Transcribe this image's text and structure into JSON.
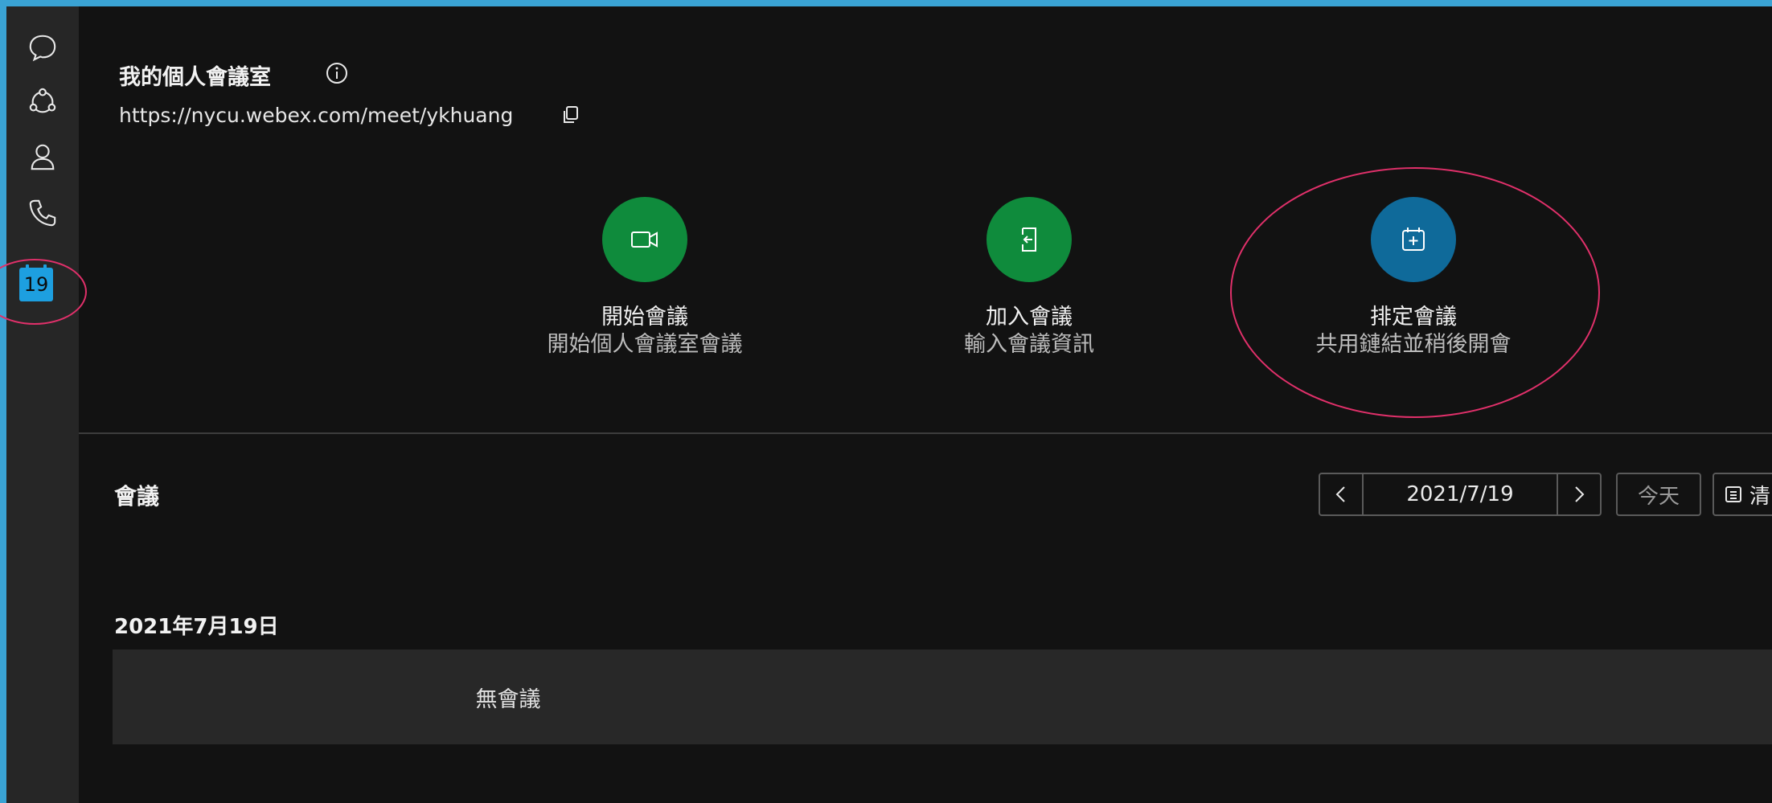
{
  "sidebar": {
    "items": [
      {
        "icon": "chat-bubble-icon",
        "label": "訊息"
      },
      {
        "icon": "teams-icon",
        "label": "小組"
      },
      {
        "icon": "contacts-icon",
        "label": "聯絡人"
      },
      {
        "icon": "phone-icon",
        "label": "通話"
      },
      {
        "icon": "calendar-icon",
        "label": "19"
      }
    ]
  },
  "personal_room": {
    "title": "我的個人會議室",
    "url": "https://nycu.webex.com/meet/ykhuang"
  },
  "actions": [
    {
      "title": "開始會議",
      "subtitle": "開始個人會議室會議",
      "icon": "video-camera-icon",
      "color": "#0f8b3c"
    },
    {
      "title": "加入會議",
      "subtitle": "輸入會議資訊",
      "icon": "join-door-icon",
      "color": "#0f8b3c"
    },
    {
      "title": "排定會議",
      "subtitle": "共用鏈結並稍後開會",
      "icon": "calendar-add-icon",
      "color": "#0f6a9a"
    }
  ],
  "meetings": {
    "title": "會議",
    "date_value": "2021/7/19",
    "today_label": "今天",
    "list_label": "清",
    "date_heading": "2021年7月19日",
    "empty_text": "無會議"
  },
  "colors": {
    "accent_green": "#0f8b3c",
    "accent_blue": "#0f6a9a",
    "highlight_annotation": "#e0306a",
    "calendar_badge": "#1d9fe0"
  }
}
